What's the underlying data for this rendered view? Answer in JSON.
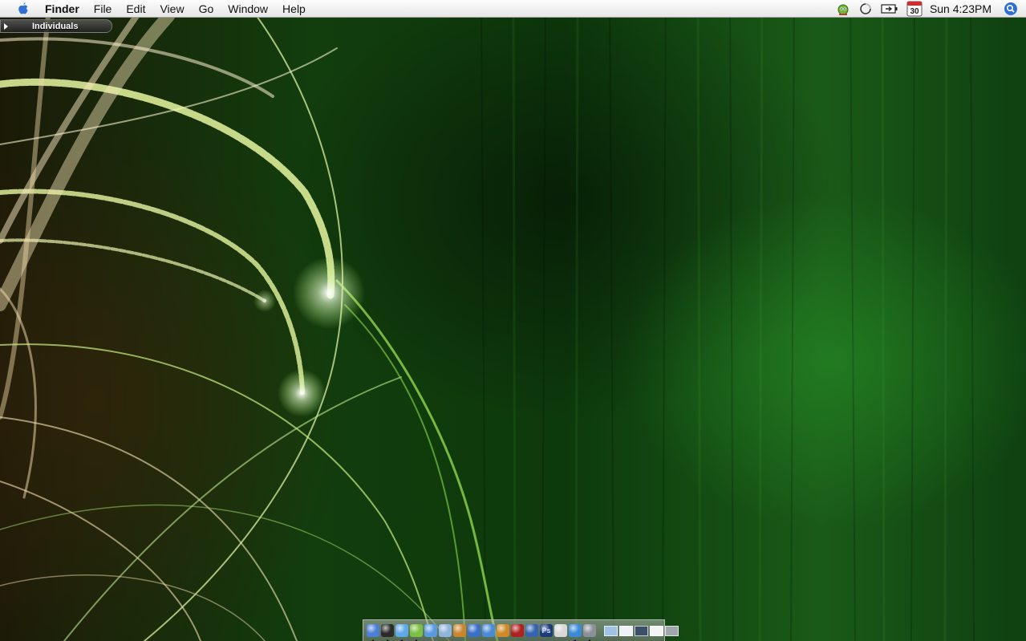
{
  "menubar": {
    "app_name": "Finder",
    "menus": [
      "File",
      "Edit",
      "View",
      "Go",
      "Window",
      "Help"
    ],
    "clock": "Sun 4:23PM",
    "calendar_day": "30",
    "extras": [
      "adium-icon",
      "sync-icon",
      "battery-icon",
      "calendar-icon",
      "spotlight-icon"
    ]
  },
  "drawer": {
    "label": "Individuals"
  },
  "dock": {
    "apps": [
      {
        "name": "finder-icon",
        "color": "#4d7fd6",
        "running": true
      },
      {
        "name": "dashboard-icon",
        "color": "#2a2a2a",
        "running": true
      },
      {
        "name": "safari-icon",
        "color": "#5fa8e8",
        "running": true
      },
      {
        "name": "adium-icon",
        "color": "#7bc043",
        "running": true
      },
      {
        "name": "itunes-icon",
        "color": "#5a9be0",
        "running": false
      },
      {
        "name": "iphoto-icon",
        "color": "#8fb3d9",
        "running": false
      },
      {
        "name": "imovie-icon",
        "color": "#c9862e",
        "running": false
      },
      {
        "name": "ical-icon",
        "color": "#3a70c9",
        "running": false
      },
      {
        "name": "mail-icon",
        "color": "#4b8bd6",
        "running": false
      },
      {
        "name": "garageband-icon",
        "color": "#d08a2a",
        "running": false
      },
      {
        "name": "dictionary-icon",
        "color": "#b02020",
        "running": false
      },
      {
        "name": "word-icon",
        "color": "#3463b0",
        "running": false
      },
      {
        "name": "photoshop-icon",
        "color": "#1d3a7a",
        "running": false,
        "label": "Ps"
      },
      {
        "name": "preview-icon",
        "color": "#d8d8d8",
        "running": false
      },
      {
        "name": "network-icon",
        "color": "#3b8ad9",
        "running": true
      },
      {
        "name": "utilities-icon",
        "color": "#8a8f98",
        "running": true
      }
    ],
    "docs": [
      {
        "name": "folder-stack-icon",
        "color": "#9fc3e6"
      },
      {
        "name": "document-icon",
        "color": "#eef2f6"
      },
      {
        "name": "photo-thumbnail-icon",
        "color": "#3b5068"
      },
      {
        "name": "document-white-icon",
        "color": "#f4f4f4"
      },
      {
        "name": "trash-icon",
        "color": "#a0a7ad"
      }
    ]
  }
}
